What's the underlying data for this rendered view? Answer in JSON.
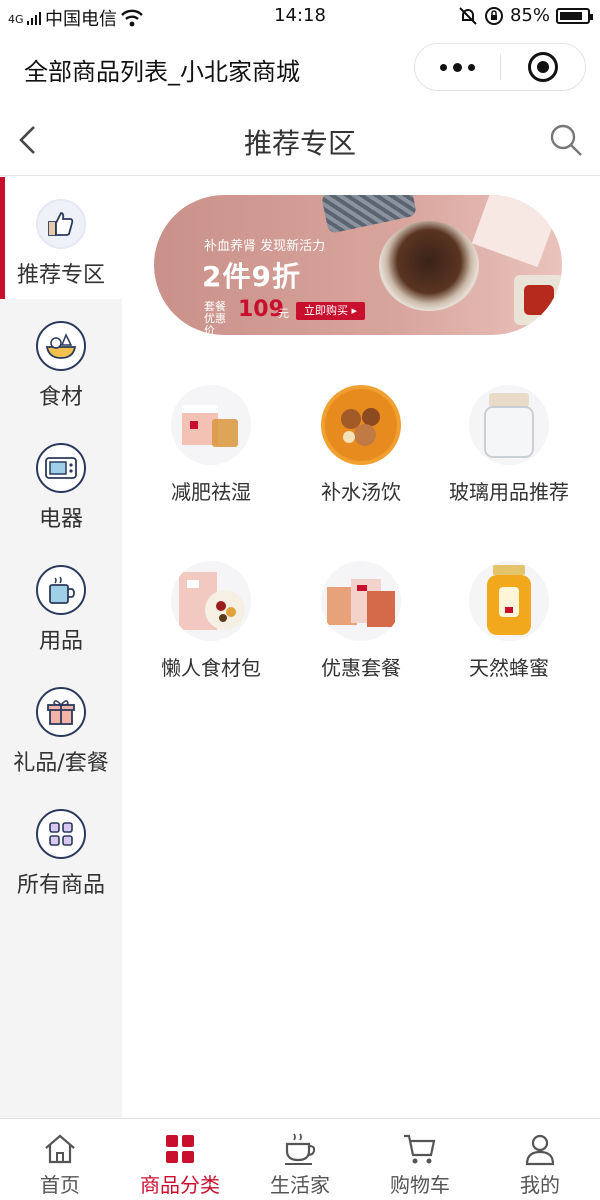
{
  "status_bar": {
    "carrier": "中国电信",
    "network": "4G",
    "time": "14:18",
    "battery": "85%",
    "battery_level": 0.85
  },
  "mp_header": {
    "title": "全部商品列表_小北家商城"
  },
  "nav": {
    "title": "推荐专区"
  },
  "sidebar": {
    "items": [
      {
        "label": "推荐专区",
        "icon": "thumbs-up-icon",
        "active": true
      },
      {
        "label": "食材",
        "icon": "food-bowl-icon"
      },
      {
        "label": "电器",
        "icon": "microwave-icon"
      },
      {
        "label": "用品",
        "icon": "cup-icon"
      },
      {
        "label": "礼品/套餐",
        "icon": "gift-icon"
      },
      {
        "label": "所有商品",
        "icon": "grid-icon"
      }
    ]
  },
  "banner": {
    "subtitle": "补血养肾 发现新活力",
    "headline": "2件9折",
    "price_label": "套餐优惠价",
    "price": "109",
    "price_unit": "元",
    "button": "立即购买 ▸"
  },
  "categories": [
    {
      "name": "减肥祛湿"
    },
    {
      "name": "补水汤饮"
    },
    {
      "name": "玻璃用品推荐"
    },
    {
      "name": "懒人食材包"
    },
    {
      "name": "优惠套餐"
    },
    {
      "name": "天然蜂蜜"
    }
  ],
  "tabbar": {
    "items": [
      {
        "label": "首页",
        "icon": "home-icon"
      },
      {
        "label": "商品分类",
        "icon": "category-icon",
        "active": true
      },
      {
        "label": "生活家",
        "icon": "coffee-cup-icon"
      },
      {
        "label": "购物车",
        "icon": "cart-icon"
      },
      {
        "label": "我的",
        "icon": "user-icon"
      }
    ]
  },
  "colors": {
    "accent": "#c8102e",
    "sidebar_bg": "#f4f4f4",
    "icon_navy": "#2b3a5c"
  }
}
